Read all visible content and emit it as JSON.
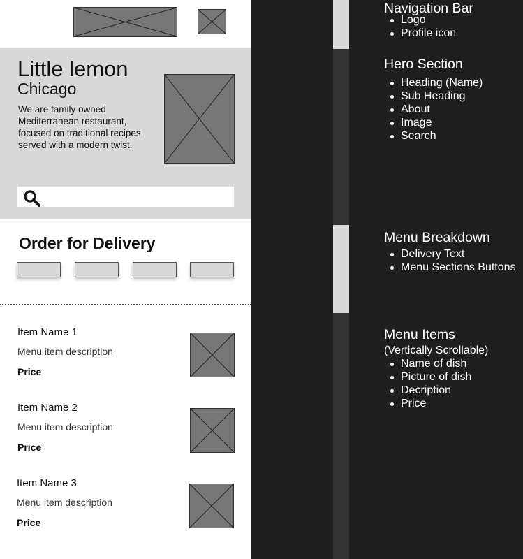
{
  "wireframe": {
    "hero": {
      "title": "Little lemon",
      "subtitle": "Chicago",
      "about": "We are family owned Mediterranean restaurant, focused on traditional recipes served with a modern twist."
    },
    "order_title": "Order for Delivery",
    "menu_items": [
      {
        "name": "Item Name 1",
        "description": "Menu item description",
        "price": "Price"
      },
      {
        "name": "Item Name 2",
        "description": "Menu item description",
        "price": "Price"
      },
      {
        "name": "Item Name 3",
        "description": "Menu item description",
        "price": "Price"
      }
    ]
  },
  "annotations": [
    {
      "title": "Navigation Bar",
      "items": [
        "Logo",
        "Profile icon"
      ]
    },
    {
      "title": "Hero Section",
      "items": [
        "Heading (Name)",
        "Sub Heading",
        "About",
        "Image",
        "Search"
      ]
    },
    {
      "title": "Menu Breakdown",
      "items": [
        "Delivery Text",
        "Menu Sections Buttons"
      ]
    },
    {
      "title": "Menu Items",
      "note": "(Vertically Scrollable)",
      "items": [
        "Name of dish",
        "Picture of dish",
        "Decription",
        "Price"
      ]
    }
  ],
  "colors": {
    "background": "#1e1e1e",
    "wireframe_bg": "#ffffff",
    "hero_bg": "#d9d9d9",
    "placeholder": "#777777",
    "bar_light": "#d9d9d9",
    "bar_dark": "#333333"
  },
  "icons": {
    "search": "search-icon",
    "image_placeholder": "image-placeholder-icon"
  }
}
